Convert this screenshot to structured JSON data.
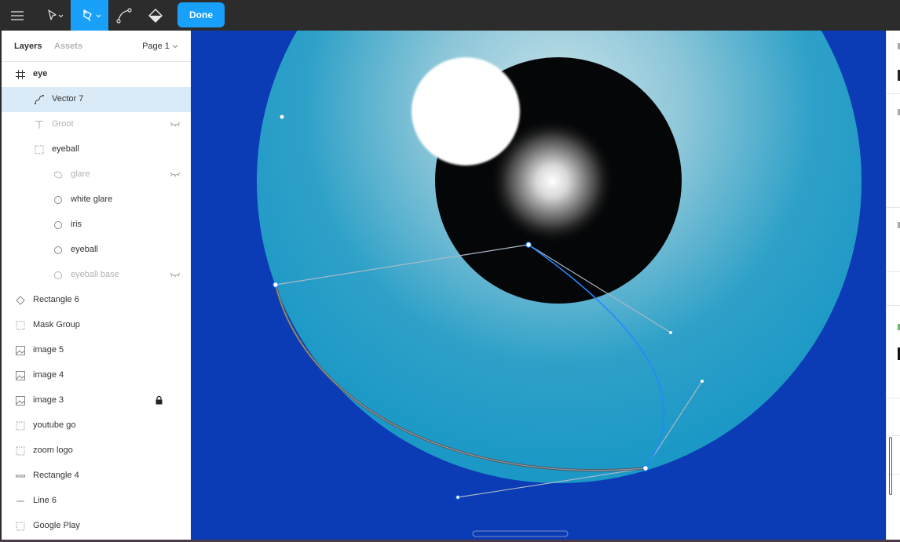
{
  "toolbar": {
    "menu_icon": "hamburger-icon",
    "move_tool_icon": "pointer-icon",
    "pen_tool_icon": "pen-icon",
    "bend_tool_icon": "bend-icon",
    "paint_bucket_icon": "paint-bucket-icon",
    "done_label": "Done",
    "accent_color": "#18a0fb"
  },
  "layers_panel": {
    "tab_layers": "Layers",
    "tab_assets": "Assets",
    "page_selector": "Page 1",
    "items": [
      {
        "label": "eye",
        "icon": "frame-icon",
        "bold": true
      },
      {
        "label": "Vector 7",
        "icon": "vector-icon",
        "selected": true
      },
      {
        "label": "Groot",
        "icon": "text-icon",
        "hidden": true
      },
      {
        "label": "eyeball",
        "icon": "group-icon"
      },
      {
        "label": "glare",
        "icon": "ellipse-icon",
        "hidden": true
      },
      {
        "label": "white glare",
        "icon": "ellipse-icon"
      },
      {
        "label": "iris",
        "icon": "ellipse-icon"
      },
      {
        "label": "eyeball",
        "icon": "ellipse-icon"
      },
      {
        "label": "eyeball base",
        "icon": "ellipse-icon",
        "hidden": true
      },
      {
        "label": "Rectangle 6",
        "icon": "diamond-icon"
      },
      {
        "label": "Mask Group",
        "icon": "group-icon"
      },
      {
        "label": "image 5",
        "icon": "image-icon"
      },
      {
        "label": "image 4",
        "icon": "image-icon"
      },
      {
        "label": "image 3",
        "icon": "image-icon",
        "locked": true
      },
      {
        "label": "youtube go",
        "icon": "group-icon"
      },
      {
        "label": "zoom logo",
        "icon": "group-icon"
      },
      {
        "label": "Rectangle 4",
        "icon": "rectangle-icon"
      },
      {
        "label": "Line 6",
        "icon": "line-icon"
      },
      {
        "label": "Google Play",
        "icon": "group-icon"
      }
    ]
  },
  "canvas": {
    "background_color": "#0b3bb5",
    "eyeball_color": "#1f9bc4",
    "iris_color": "#050607"
  }
}
